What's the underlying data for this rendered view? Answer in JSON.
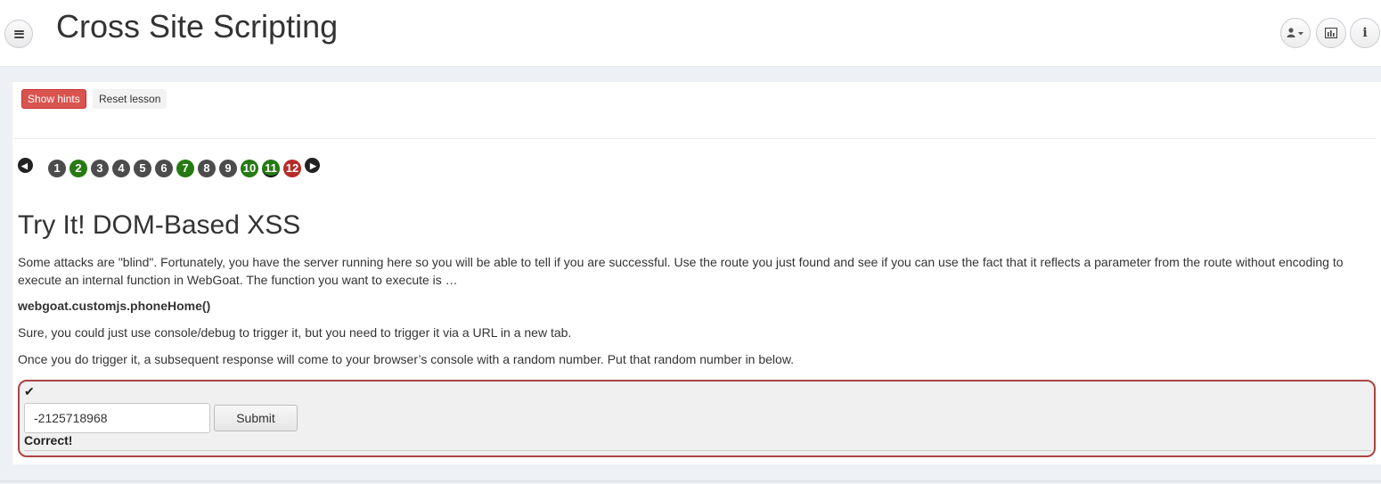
{
  "header": {
    "title": "Cross Site Scripting",
    "menu_icon": "hamburger-icon",
    "right_buttons": [
      {
        "icon": "user-icon",
        "has_caret": true
      },
      {
        "icon": "bar-chart-icon"
      },
      {
        "icon": "info-icon",
        "glyph": "i"
      }
    ]
  },
  "toolbar": {
    "show_hints_label": "Show hints",
    "reset_lesson_label": "Reset lesson"
  },
  "pagination": {
    "prev_glyph": "◀",
    "next_glyph": "▶",
    "pages": [
      {
        "label": "1",
        "status": "default",
        "color": "#4c4c4c"
      },
      {
        "label": "2",
        "status": "solved",
        "color": "#267a14"
      },
      {
        "label": "3",
        "status": "default",
        "color": "#4c4c4c"
      },
      {
        "label": "4",
        "status": "default",
        "color": "#4c4c4c"
      },
      {
        "label": "5",
        "status": "default",
        "color": "#4c4c4c"
      },
      {
        "label": "6",
        "status": "default",
        "color": "#4c4c4c"
      },
      {
        "label": "7",
        "status": "solved",
        "color": "#267a14"
      },
      {
        "label": "8",
        "status": "default",
        "color": "#4c4c4c"
      },
      {
        "label": "9",
        "status": "default",
        "color": "#4c4c4c"
      },
      {
        "label": "10",
        "status": "solved",
        "color": "#267a14"
      },
      {
        "label": "11",
        "status": "current-solved",
        "color": "#267a14"
      },
      {
        "label": "12",
        "status": "unsolved",
        "color": "#b52b27"
      }
    ]
  },
  "lesson": {
    "title": "Try It! DOM-Based XSS",
    "para1": "Some attacks are \"blind\". Fortunately, you have the server running here so you will be able to tell if you are successful. Use the route you just found and see if you can use the fact that it reflects a parameter from the route without encoding to execute an internal function in WebGoat. The function you want to execute is …",
    "function_name": "webgoat.customjs.phoneHome()",
    "para2": "Sure, you could just use console/debug to trigger it, but you need to trigger it via a URL in a new tab.",
    "para3": "Once you do trigger it, a subsequent response will come to your browser’s console with a random number. Put that random number in below."
  },
  "attack_form": {
    "status_icon": "checkmark-icon",
    "status_glyph": "✔",
    "answer_value": "-2125718968",
    "submit_label": "Submit",
    "feedback": "Correct!"
  },
  "colors": {
    "hint_button": "#d9534f",
    "solved": "#267a14",
    "unsolved": "#b52b27",
    "default_page": "#4c4c4c",
    "attack_border": "#a94442"
  }
}
